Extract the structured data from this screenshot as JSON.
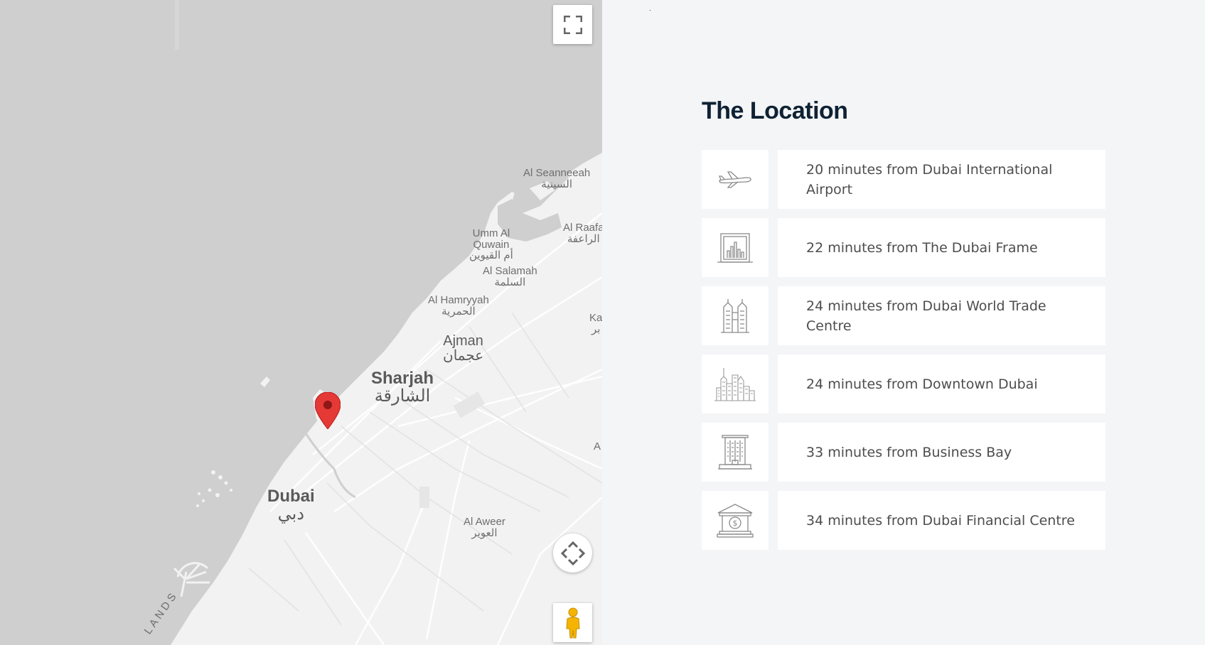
{
  "map": {
    "labels": [
      {
        "id": "al-seanneeah",
        "en": "Al Seanneeah",
        "ar": "السينية"
      },
      {
        "id": "umm-al-quwain",
        "en": "Umm Al\nQuwain",
        "ar": "أم القيوين"
      },
      {
        "id": "al-raafah",
        "en": "Al Raafa",
        "ar": "الراعفة"
      },
      {
        "id": "al-salamah",
        "en": "Al Salamah",
        "ar": "السلمة"
      },
      {
        "id": "al-hamriyah",
        "en": "Al Hamryyah",
        "ar": "الحمرية"
      },
      {
        "id": "ajman",
        "en": "Ajman",
        "ar": "عجمان"
      },
      {
        "id": "sharjah",
        "en": "Sharjah",
        "ar": "الشارقة"
      },
      {
        "id": "dubai",
        "en": "Dubai",
        "ar": "دبي"
      },
      {
        "id": "al-aweer",
        "en": "Al Aweer",
        "ar": "العوير"
      },
      {
        "id": "ka",
        "en": "Ka",
        "ar": "ﺑﺮ"
      },
      {
        "id": "edge-a",
        "en": "A",
        "ar": ""
      },
      {
        "id": "islands",
        "en": "LANDS",
        "ar": ""
      }
    ],
    "buttons": {
      "fullscreen": "fullscreen-icon",
      "pan": "move-arrows-icon",
      "street_view": "pegman-icon"
    }
  },
  "location": {
    "title": "The Location",
    "items": [
      {
        "icon": "airplane-icon",
        "text": "20 minutes from Dubai International Airport"
      },
      {
        "icon": "dubai-frame-icon",
        "text": "22 minutes from The Dubai Frame"
      },
      {
        "icon": "trade-centre-icon",
        "text": "24 minutes from Dubai World Trade Centre"
      },
      {
        "icon": "downtown-skyline-icon",
        "text": "24 minutes from Downtown Dubai"
      },
      {
        "icon": "office-tower-icon",
        "text": "33 minutes from Business Bay"
      },
      {
        "icon": "bank-icon",
        "text": "34 minutes from Dubai Financial Centre"
      }
    ]
  },
  "colors": {
    "sea": "#cfcfcf",
    "land": "#f2f2f2",
    "road": "#ffffff",
    "marker": "#e53935",
    "title": "#0f2233",
    "panel_bg": "#f4f5f7"
  }
}
